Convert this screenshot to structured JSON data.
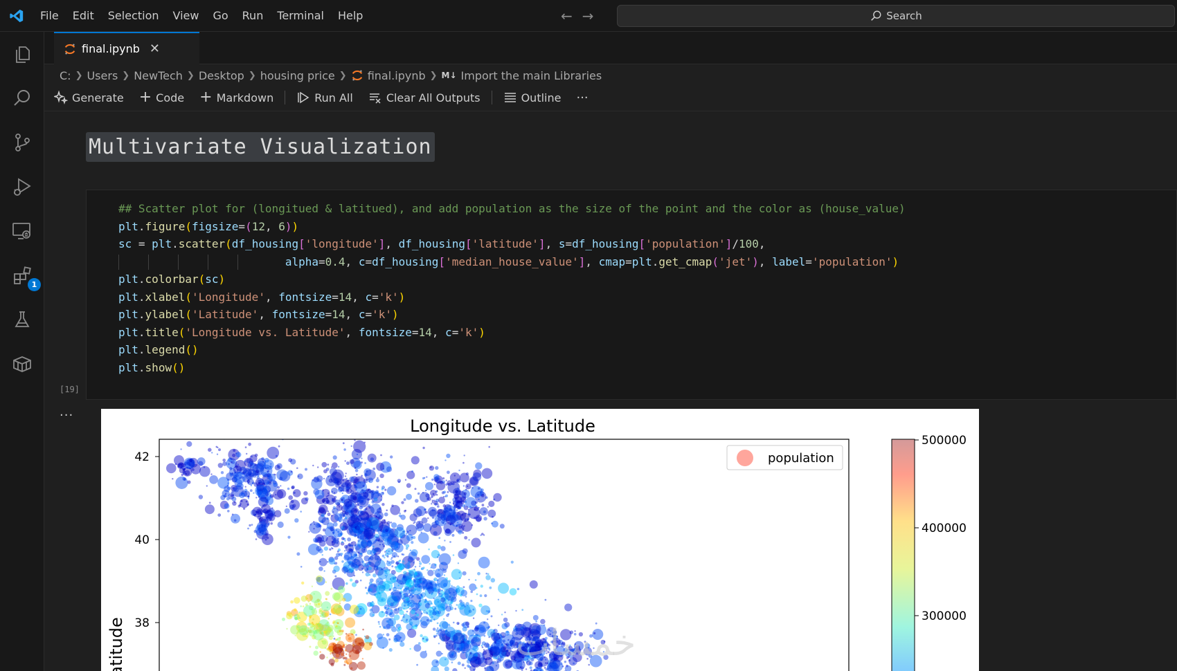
{
  "menu": {
    "items": [
      "File",
      "Edit",
      "Selection",
      "View",
      "Go",
      "Run",
      "Terminal",
      "Help"
    ]
  },
  "search": {
    "placeholder": "Search"
  },
  "activity_bar": {
    "items": [
      "explorer-icon",
      "search-icon",
      "source-control-icon",
      "run-debug-icon",
      "remote-explorer-icon",
      "extensions-icon",
      "testing-icon",
      "packages-icon"
    ],
    "extensions_badge": "1"
  },
  "tab": {
    "label": "final.ipynb",
    "icon": "jupyter-icon"
  },
  "breadcrumb": {
    "items": [
      "C:",
      "Users",
      "NewTech",
      "Desktop",
      "housing price",
      "final.ipynb",
      "Import the main Libraries"
    ],
    "md_tag": "M↓"
  },
  "toolbar": {
    "generate": "Generate",
    "code": "Code",
    "markdown": "Markdown",
    "run_all": "Run All",
    "clear_outputs": "Clear All Outputs",
    "outline": "Outline",
    "more": "···"
  },
  "markdown_cell": {
    "heading": "Multivariate Visualization"
  },
  "code_cell": {
    "execution_count": "[19]",
    "output_ellipsis": "···"
  },
  "colors": {
    "accent": "#0078d4",
    "background": "#1f1f1f",
    "sidebar": "#181818"
  },
  "chart_data": {
    "type": "scatter",
    "title": "Longitude vs. Latitude",
    "ylabel": "Latitude",
    "legend": {
      "label": "population",
      "placement": "top-right"
    },
    "y_ticks": [
      42,
      40,
      38
    ],
    "colorbar": {
      "ticks": [
        500000,
        400000,
        300000
      ],
      "cmap": "jet"
    }
  },
  "watermark": "خمسات"
}
